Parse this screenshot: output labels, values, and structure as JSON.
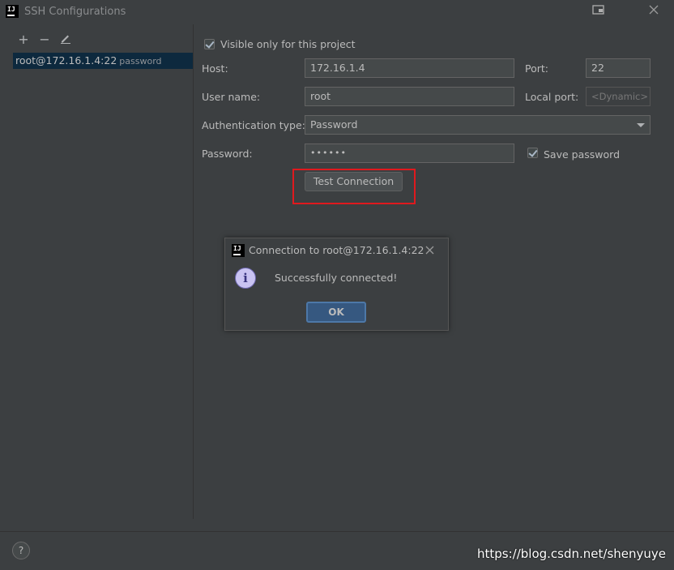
{
  "window": {
    "title": "SSH Configurations",
    "logo_text": "IJ"
  },
  "toolbar": {
    "add_icon": "+",
    "remove_icon": "−",
    "edit_icon": "✎"
  },
  "config_list": [
    {
      "name": "root@172.16.1.4:22",
      "auth": "password"
    }
  ],
  "form": {
    "visible_only_label": "Visible only for this project",
    "visible_only_checked": true,
    "host_label": "Host:",
    "host_value": "172.16.1.4",
    "port_label": "Port:",
    "port_value": "22",
    "username_label": "User name:",
    "username_value": "root",
    "local_port_label": "Local port:",
    "local_port_placeholder": "<Dynamic>",
    "auth_type_label": "Authentication type:",
    "auth_type_value": "Password",
    "password_label": "Password:",
    "password_value": "••••••",
    "save_password_label": "Save password",
    "save_password_checked": true,
    "test_connection_label": "Test Connection"
  },
  "dialog": {
    "title": "Connection to root@172.16.1.4:22",
    "message": "Successfully connected!",
    "ok_label": "OK",
    "icon": "info-icon"
  },
  "footer": {
    "help_label": "?",
    "watermark": "https://blog.csdn.net/shenyuye"
  },
  "colors": {
    "background": "#3c3f41",
    "selection": "#0d293e",
    "highlight_box": "#e0191e",
    "primary_button": "#365880"
  }
}
